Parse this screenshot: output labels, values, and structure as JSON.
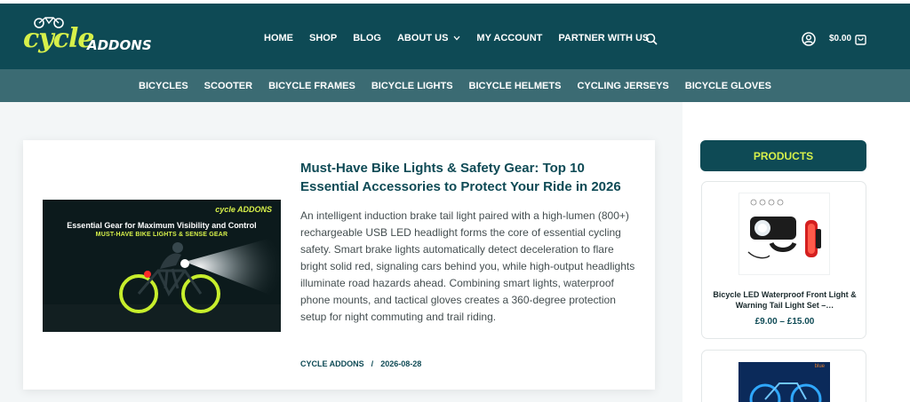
{
  "brand": {
    "logo_main": "cycle",
    "logo_sub": "ADDONS"
  },
  "main_nav": [
    {
      "label": "HOME"
    },
    {
      "label": "SHOP"
    },
    {
      "label": "BLOG"
    },
    {
      "label": "ABOUT US",
      "has_dropdown": true
    },
    {
      "label": "MY ACCOUNT"
    },
    {
      "label": "PARTNER WITH US"
    }
  ],
  "header_right": {
    "cart_total": "$0.00"
  },
  "categories": [
    "BICYCLES",
    "SCOOTER",
    "BICYCLE FRAMES",
    "BICYCLE LIGHTS",
    "BICYCLE HELMETS",
    "CYCLING JERSEYS",
    "BICYCLE GLOVES"
  ],
  "post": {
    "thumbnail": {
      "line1": "Essential Gear for Maximum Visibility and Control",
      "line2": "MUST-HAVE BIKE LIGHTS & SENSE GEAR",
      "logo": "cycle ADDONS"
    },
    "title": "Must-Have Bike Lights & Safety Gear: Top 10 Essential Accessories to Protect Your Ride in 2026",
    "excerpt": "An intelligent induction brake tail light paired with a high-lumen (800+) rechargeable USB LED headlight forms the core of essential cycling safety. Smart brake lights automatically detect deceleration to flare bright solid red, signaling cars behind you, while high-output headlights illuminate road hazards ahead. Combining smart lights, waterproof phone mounts, and tactical gloves creates a 360-degree protection setup for night commuting and trail riding.",
    "author": "CYCLE ADDONS",
    "date": "2026-08-28"
  },
  "sidebar": {
    "heading": "PRODUCTS",
    "products": [
      {
        "title": "Bicycle LED Waterproof Front Light & Warning Tail Light Set –…",
        "price": "£9.00 – £15.00"
      },
      {
        "badge": "blue"
      }
    ]
  },
  "colors": {
    "header_bg": "#0e4a55",
    "category_bar_bg": "#3b6b73",
    "accent_lime": "#d7f04a",
    "content_bg": "#f3f6f7"
  }
}
